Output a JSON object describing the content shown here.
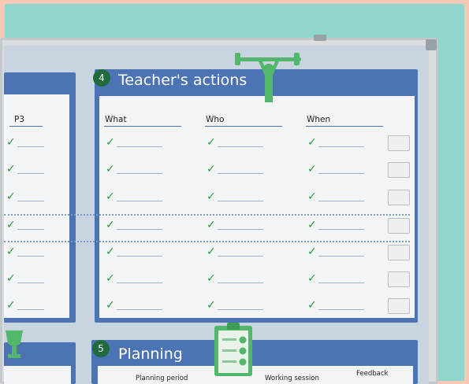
{
  "photo": {
    "panel_left": {
      "col_header": "P3"
    },
    "panel_teacher": {
      "number": "4",
      "title": "Teacher's actions",
      "columns": [
        "What",
        "Who",
        "When"
      ],
      "icon": "weightlifter-icon"
    },
    "panel_planning": {
      "number": "5",
      "title": "Planning",
      "columns": [
        "Planning period",
        "Working session",
        "Feedback"
      ],
      "icon": "clipboard-icon"
    },
    "colors": {
      "wall": "#8fd6cd",
      "panel_blue": "#4c73b4",
      "check_green": "#2d9a3e",
      "badge_green": "#1f6b3e"
    }
  }
}
